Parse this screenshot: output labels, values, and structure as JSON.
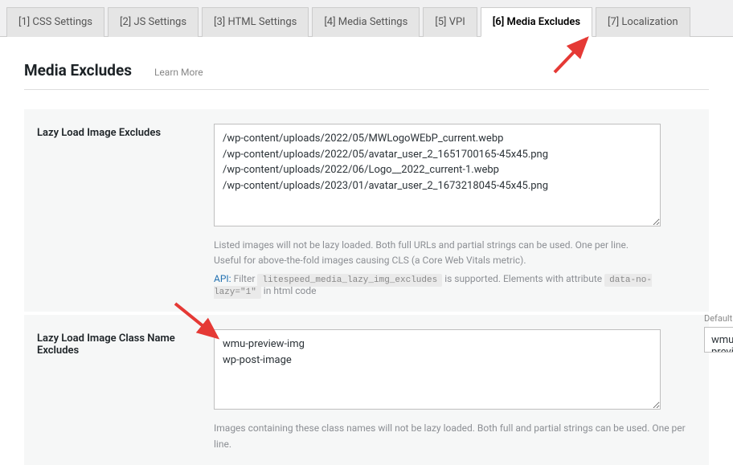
{
  "tabs": [
    {
      "label": "[1] CSS Settings"
    },
    {
      "label": "[2] JS Settings"
    },
    {
      "label": "[3] HTML Settings"
    },
    {
      "label": "[4] Media Settings"
    },
    {
      "label": "[5] VPI"
    },
    {
      "label": "[6] Media Excludes"
    },
    {
      "label": "[7] Localization"
    }
  ],
  "page": {
    "title": "Media Excludes",
    "learn_more": "Learn More"
  },
  "settings": {
    "lazyload_img": {
      "label": "Lazy Load Image Excludes",
      "value": "/wp-content/uploads/2022/05/MWLogoWEbP_current.webp\n/wp-content/uploads/2022/05/avatar_user_2_1651700165-45x45.png\n/wp-content/uploads/2022/06/Logo__2022_current-1.webp\n/wp-content/uploads/2023/01/avatar_user_2_1673218045-45x45.png",
      "help1": "Listed images will not be lazy loaded. Both full URLs and partial strings can be used. One per line.",
      "help2": "Useful for above-the-fold images causing CLS (a Core Web Vitals metric).",
      "api_label": "API:",
      "api_filter": "Filter",
      "api_code": "litespeed_media_lazy_img_excludes",
      "api_text1": "is supported. Elements with attribute",
      "api_code2": "data-no-lazy=\"1\"",
      "api_text2": "in html code"
    },
    "lazyload_class": {
      "label": "Lazy Load Image Class Name Excludes",
      "value": "wmu-preview-img\nwp-post-image",
      "help": "Images containing these class names will not be lazy loaded. Both full and partial strings can be used. One per line.",
      "default_label": "Default value:",
      "default_value": "wmu-previe"
    }
  }
}
